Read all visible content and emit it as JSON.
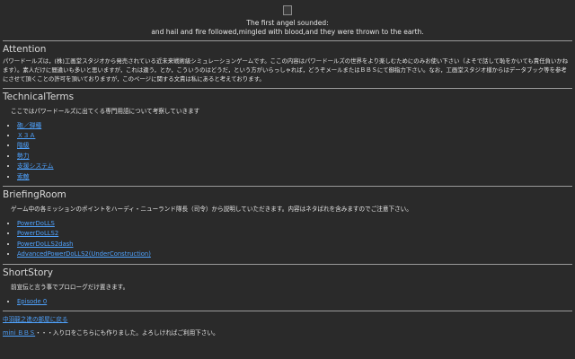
{
  "banner": {
    "quote_line_1": "The first angel sounded:",
    "quote_line_2": "and hail and fire followed,mingled with blood,and they were thrown to the earth."
  },
  "attention": {
    "heading": "Attention",
    "text": "パワードールズは，(株)工画堂スタジオから発売されている近未来戦術級シミュレーションゲームです。ここの内容はパワードールズの世界をより楽しむためにのみお使い下さい（よそで話して恥をかいても責任負いかねます）。素人だけに間違いも多いと思いますが，これは違う，とか，こういうのはどうだ，という方がいらっしゃれば，どうぞメールまたはＢＢＳにて御指力下さい。なお，工画堂スタジオ様からはデータブック等を参考にさせて頂くことの許可を頂いておりますが，このページに関する文責は私にあると考えております。"
  },
  "technical_terms": {
    "heading": "TechnicalTerms",
    "lead": "ここではパワードールズに出てくる専門用語について考察していきます",
    "links": [
      "砲／弾種",
      "Ｘ３Ａ",
      "階級",
      "勢力",
      "支援システム",
      "索敵"
    ]
  },
  "briefing_room": {
    "heading": "BriefingRoom",
    "lead": "ゲーム中の各ミッションのポイントをハーディ・ニューランド隊長（司令）から説明していただきます。内容はネタばれを含みますのでご注意下さい。",
    "links": [
      "PowerDoLLS",
      "PowerDoLLS2",
      "PowerDoLLS2dash",
      "AdvancedPowerDoLLS2(UnderConstruction)"
    ]
  },
  "short_story": {
    "heading": "ShortStory",
    "lead": "前宣伝と言う事でプロローグだけ置きます。",
    "links": [
      "Episode 0"
    ]
  },
  "footer": {
    "back_link": "中羽龍之進の部屋に戻る",
    "bbs_link": "mini ＢＢＳ",
    "bbs_text": "・・・入り口をこちらにも作りました。よろしければご利用下さい。"
  },
  "colors": {
    "background": "#2a2a2a",
    "text": "#e6e6e6",
    "link": "#4fa3ff",
    "divider": "#9a9a9a"
  },
  "icons": {
    "banner_image": "broken-image-icon"
  }
}
